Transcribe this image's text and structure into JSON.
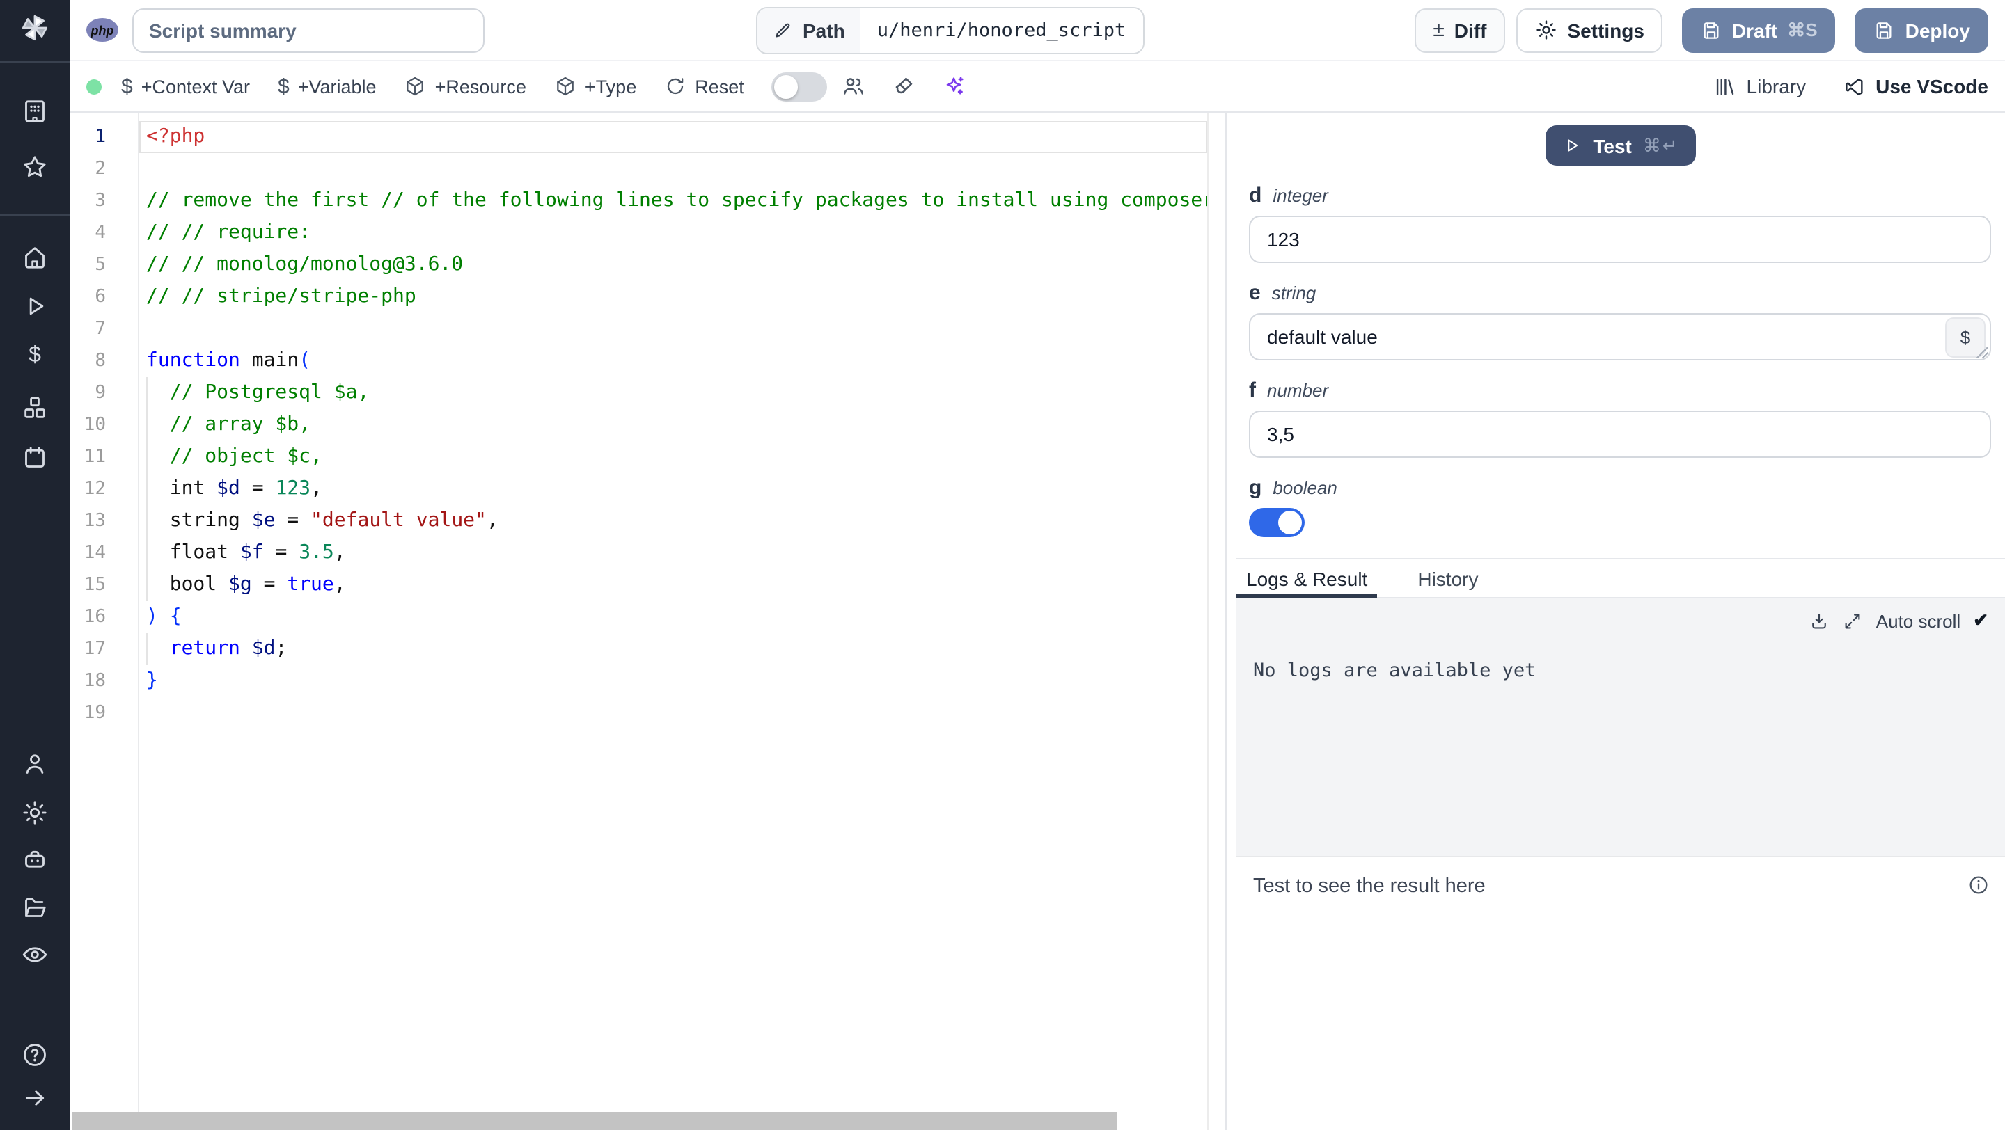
{
  "topbar": {
    "language_badge": "php",
    "summary_placeholder": "Script summary",
    "path_label": "Path",
    "path_value": "u/henri/honored_script",
    "diff_glyph": "±",
    "diff_label": "Diff",
    "settings_label": "Settings",
    "draft_label": "Draft",
    "draft_shortcut": "⌘S",
    "deploy_label": "Deploy"
  },
  "toolbar": {
    "status": "ready",
    "dollar_glyph": "$",
    "add_context_var": "+Context Var",
    "add_variable": "+Variable",
    "add_resource": "+Resource",
    "add_type": "+Type",
    "reset_label": "Reset",
    "assistant_toggle": "off",
    "library_label": "Library",
    "vscode_label": "Use VScode"
  },
  "colors": {
    "primary_button": "#6c81a5",
    "test_button": "#404f70",
    "toggle_on": "#2f68e8",
    "status_dot": "#7de2a5",
    "sparkles": "#7c3aed",
    "sidebar_bg": "#1e2430"
  },
  "editor": {
    "language": "php",
    "active_line": 1,
    "lines": [
      {
        "n": 1,
        "tokens": [
          {
            "t": "<?php",
            "c": "tag"
          }
        ]
      },
      {
        "n": 2,
        "tokens": []
      },
      {
        "n": 3,
        "tokens": [
          {
            "t": "// remove the first // of the following lines to specify packages to install using composer",
            "c": "comment"
          }
        ]
      },
      {
        "n": 4,
        "tokens": [
          {
            "t": "// // require:",
            "c": "comment"
          }
        ]
      },
      {
        "n": 5,
        "tokens": [
          {
            "t": "// // monolog/monolog@3.6.0",
            "c": "comment"
          }
        ]
      },
      {
        "n": 6,
        "tokens": [
          {
            "t": "// // stripe/stripe-php",
            "c": "comment"
          }
        ]
      },
      {
        "n": 7,
        "tokens": []
      },
      {
        "n": 8,
        "tokens": [
          {
            "t": "function",
            "c": "kw"
          },
          {
            "t": " ",
            "c": "plain"
          },
          {
            "t": "main",
            "c": "plain"
          },
          {
            "t": "(",
            "c": "bracket"
          }
        ]
      },
      {
        "n": 9,
        "guide": true,
        "tokens": [
          {
            "t": "  ",
            "c": "plain"
          },
          {
            "t": "// Postgresql $a,",
            "c": "comment"
          }
        ]
      },
      {
        "n": 10,
        "guide": true,
        "tokens": [
          {
            "t": "  ",
            "c": "plain"
          },
          {
            "t": "// array $b,",
            "c": "comment"
          }
        ]
      },
      {
        "n": 11,
        "guide": true,
        "tokens": [
          {
            "t": "  ",
            "c": "plain"
          },
          {
            "t": "// object $c,",
            "c": "comment"
          }
        ]
      },
      {
        "n": 12,
        "guide": true,
        "tokens": [
          {
            "t": "  int ",
            "c": "plain"
          },
          {
            "t": "$d",
            "c": "var"
          },
          {
            "t": " = ",
            "c": "plain"
          },
          {
            "t": "123",
            "c": "num"
          },
          {
            "t": ",",
            "c": "plain"
          }
        ]
      },
      {
        "n": 13,
        "guide": true,
        "tokens": [
          {
            "t": "  string ",
            "c": "plain"
          },
          {
            "t": "$e",
            "c": "var"
          },
          {
            "t": " = ",
            "c": "plain"
          },
          {
            "t": "\"default value\"",
            "c": "str"
          },
          {
            "t": ",",
            "c": "plain"
          }
        ]
      },
      {
        "n": 14,
        "guide": true,
        "tokens": [
          {
            "t": "  float ",
            "c": "plain"
          },
          {
            "t": "$f",
            "c": "var"
          },
          {
            "t": " = ",
            "c": "plain"
          },
          {
            "t": "3.5",
            "c": "num"
          },
          {
            "t": ",",
            "c": "plain"
          }
        ]
      },
      {
        "n": 15,
        "guide": true,
        "tokens": [
          {
            "t": "  bool ",
            "c": "plain"
          },
          {
            "t": "$g",
            "c": "var"
          },
          {
            "t": " = ",
            "c": "plain"
          },
          {
            "t": "true",
            "c": "kw"
          },
          {
            "t": ",",
            "c": "plain"
          }
        ]
      },
      {
        "n": 16,
        "tokens": [
          {
            "t": ") {",
            "c": "bracket"
          }
        ]
      },
      {
        "n": 17,
        "guide": true,
        "tokens": [
          {
            "t": "  ",
            "c": "plain"
          },
          {
            "t": "return",
            "c": "kw"
          },
          {
            "t": " ",
            "c": "plain"
          },
          {
            "t": "$d",
            "c": "var"
          },
          {
            "t": ";",
            "c": "plain"
          }
        ]
      },
      {
        "n": 18,
        "tokens": [
          {
            "t": "}",
            "c": "bracket"
          }
        ]
      },
      {
        "n": 19,
        "tokens": []
      }
    ]
  },
  "panel": {
    "test_label": "Test",
    "test_shortcut": "⌘↵",
    "fields": [
      {
        "name": "d",
        "type": "integer",
        "value": "123"
      },
      {
        "name": "e",
        "type": "string",
        "value": "default value",
        "button": "$"
      },
      {
        "name": "f",
        "type": "number",
        "value": "3,5"
      },
      {
        "name": "g",
        "type": "boolean",
        "value": "on"
      }
    ],
    "tabs": [
      "Logs & Result",
      "History"
    ],
    "active_tab": "Logs & Result",
    "auto_scroll_label": "Auto scroll",
    "auto_scroll_check": "✔",
    "no_logs_message": "No logs are available yet",
    "result_placeholder": "Test to see the result here"
  }
}
